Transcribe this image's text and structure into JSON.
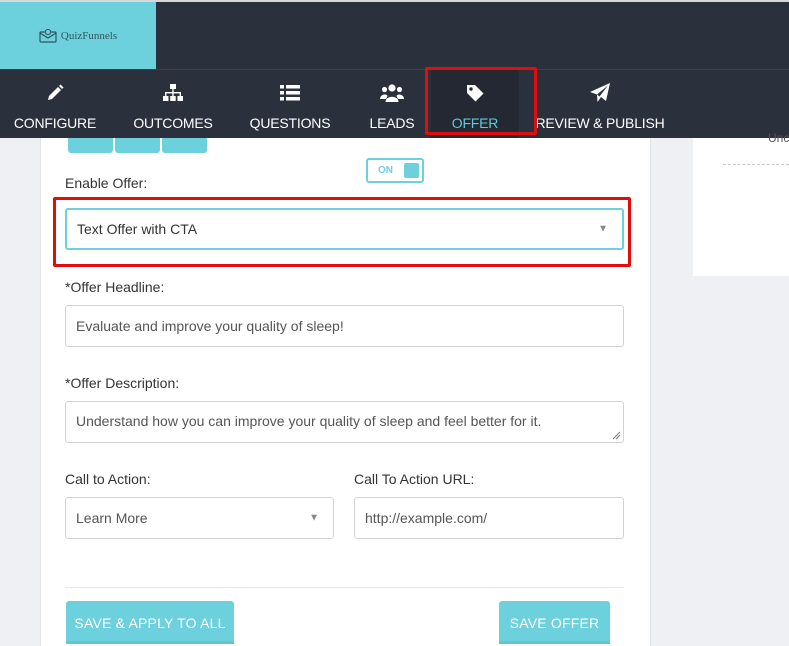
{
  "header": {
    "logo_text": "QuizFunnels"
  },
  "nav": {
    "items": [
      {
        "label": "CONFIGURE",
        "icon": "pencil-icon"
      },
      {
        "label": "OUTCOMES",
        "icon": "sitemap-icon"
      },
      {
        "label": "QUESTIONS",
        "icon": "list-icon"
      },
      {
        "label": "LEADS",
        "icon": "users-icon"
      },
      {
        "label": "OFFER",
        "icon": "tag-icon",
        "active": true
      },
      {
        "label": "REVIEW & PUBLISH",
        "icon": "paper-plane-icon"
      }
    ]
  },
  "offer_form": {
    "toggle_label": "ON",
    "enable_offer_label": "Enable Offer:",
    "enable_offer_value": "Text Offer with CTA",
    "headline_label": "*Offer Headline:",
    "headline_value": "Evaluate and improve your quality of sleep!",
    "description_label": "*Offer Description:",
    "description_value": "Understand how you can improve your quality of sleep and feel better for it.",
    "cta_label": "Call to Action:",
    "cta_value": "Learn More",
    "cta_url_label": "Call To Action URL:",
    "cta_url_placeholder": "http://example.com/",
    "save_apply_all_label": "SAVE & APPLY TO ALL",
    "save_offer_label": "SAVE OFFER"
  },
  "right_panel": {
    "partial_text": "Unc"
  },
  "colors": {
    "accent": "#6dd0dd",
    "nav_bg": "#2b303d",
    "highlight": "#e00d0d",
    "active_label": "#5ec9da"
  }
}
